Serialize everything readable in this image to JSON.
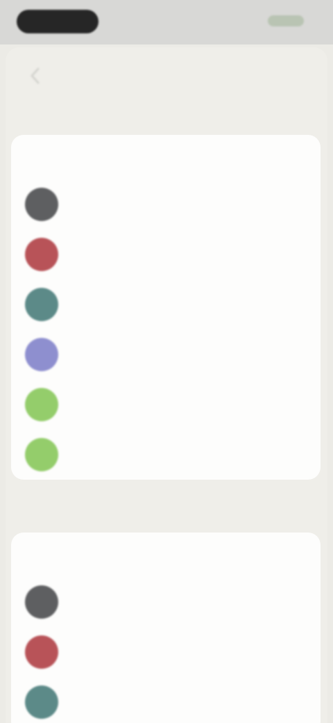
{
  "status_bar": {
    "pill_label": "",
    "right_indicator": ""
  },
  "nav": {
    "title": "",
    "back_icon": "chevron-left-icon"
  },
  "sections": [
    {
      "header": "",
      "card_title": "",
      "items": [
        {
          "label": "",
          "color": "#5e5f61"
        },
        {
          "label": "",
          "color": "#b85358"
        },
        {
          "label": "",
          "color": "#5c8a88"
        },
        {
          "label": "",
          "color": "#8e8fcf"
        },
        {
          "label": "",
          "color": "#94cd6b"
        },
        {
          "label": "",
          "color": "#94cd6b"
        }
      ]
    },
    {
      "header": "",
      "card_title": "",
      "items": [
        {
          "label": "",
          "color": "#5e5f61"
        },
        {
          "label": "",
          "color": "#b85358"
        },
        {
          "label": "",
          "color": "#5c8a88"
        }
      ]
    }
  ]
}
